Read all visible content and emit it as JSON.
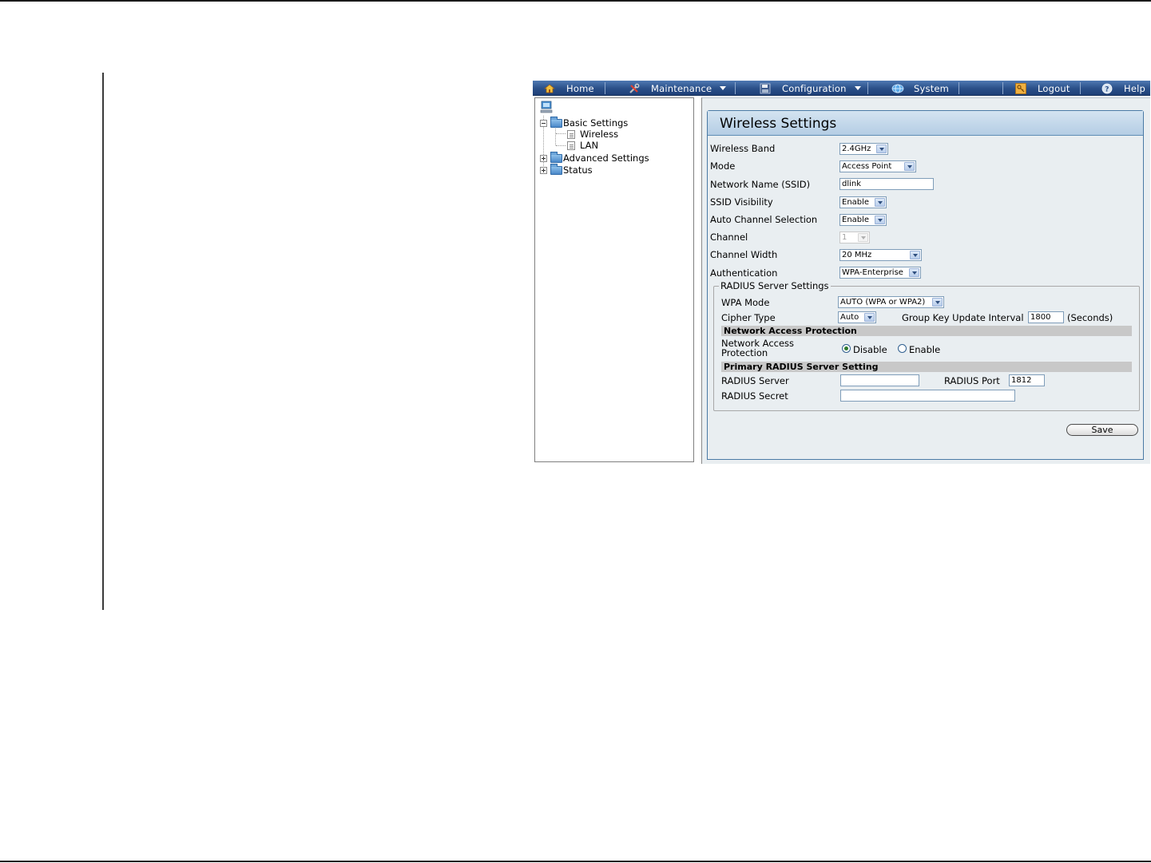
{
  "nav": {
    "home": "Home",
    "maintenance": "Maintenance",
    "configuration": "Configuration",
    "system": "System",
    "logout": "Logout",
    "help": "Help"
  },
  "tree": {
    "basic_settings": "Basic Settings",
    "wireless": "Wireless",
    "lan": "LAN",
    "advanced_settings": "Advanced Settings",
    "status": "Status"
  },
  "panel": {
    "title": "Wireless Settings"
  },
  "form": {
    "wireless_band_label": "Wireless Band",
    "wireless_band_value": "2.4GHz",
    "mode_label": "Mode",
    "mode_value": "Access Point",
    "ssid_label": "Network Name (SSID)",
    "ssid_value": "dlink",
    "ssid_visibility_label": "SSID Visibility",
    "ssid_visibility_value": "Enable",
    "auto_channel_label": "Auto Channel Selection",
    "auto_channel_value": "Enable",
    "channel_label": "Channel",
    "channel_value": "1",
    "channel_width_label": "Channel Width",
    "channel_width_value": "20 MHz",
    "authentication_label": "Authentication",
    "authentication_value": "WPA-Enterprise"
  },
  "radius": {
    "legend": "RADIUS Server Settings",
    "wpa_mode_label": "WPA Mode",
    "wpa_mode_value": "AUTO (WPA or WPA2)",
    "cipher_type_label": "Cipher Type",
    "cipher_type_value": "Auto",
    "group_key_label": "Group Key Update Interval",
    "group_key_value": "1800",
    "group_key_unit": "(Seconds)",
    "nap_header": "Network Access Protection",
    "nap_label_line1": "Network Access",
    "nap_label_line2": "Protection",
    "nap_disable": "Disable",
    "nap_enable": "Enable",
    "nap_selected": "Disable",
    "primary_header": "Primary RADIUS Server Setting",
    "server_label": "RADIUS Server",
    "server_value": "",
    "port_label": "RADIUS Port",
    "port_value": "1812",
    "secret_label": "RADIUS Secret",
    "secret_value": ""
  },
  "actions": {
    "save": "Save"
  },
  "colors": {
    "nav_bar": "#2a4f88",
    "panel_bg": "#e9eef1",
    "title_bar": "#c4d9ec",
    "band_bg": "#c8c8c8"
  }
}
